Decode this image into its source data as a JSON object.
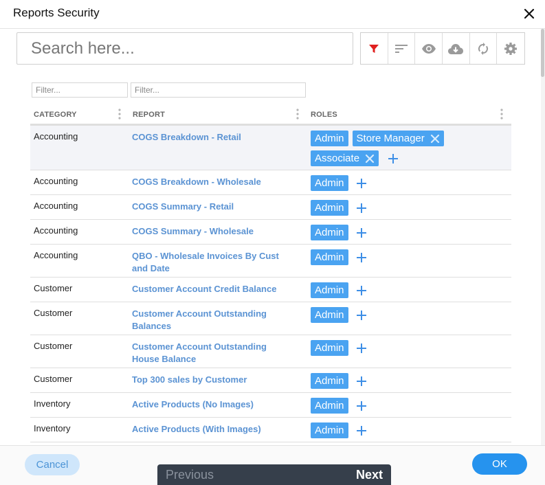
{
  "dialog": {
    "title": "Reports Security"
  },
  "search": {
    "placeholder": "Search here..."
  },
  "toolbar": {
    "icons": [
      "filter-icon",
      "sort-icon",
      "eye-icon",
      "cloud-download-icon",
      "refresh-icon",
      "gear-icon"
    ],
    "active_color": "#e0201f",
    "icon_color": "#9a9a9a"
  },
  "filters": {
    "category_placeholder": "Filter...",
    "report_placeholder": "Filter..."
  },
  "table": {
    "columns": [
      "CATEGORY",
      "REPORT",
      "ROLES"
    ],
    "add_icon": "plus-icon",
    "remove_icon": "close-icon",
    "rows": [
      {
        "category": "Accounting",
        "report": "COGS Breakdown - Retail",
        "roles": [
          "Admin",
          "Store Manager",
          "Associate"
        ]
      },
      {
        "category": "Accounting",
        "report": "COGS Breakdown - Wholesale",
        "roles": [
          "Admin"
        ]
      },
      {
        "category": "Accounting",
        "report": "COGS Summary - Retail",
        "roles": [
          "Admin"
        ]
      },
      {
        "category": "Accounting",
        "report": "COGS Summary - Wholesale",
        "roles": [
          "Admin"
        ]
      },
      {
        "category": "Accounting",
        "report": "QBO - Wholesale Invoices By Cust and Date",
        "roles": [
          "Admin"
        ]
      },
      {
        "category": "Customer",
        "report": "Customer Account Credit Balance",
        "roles": [
          "Admin"
        ]
      },
      {
        "category": "Customer",
        "report": "Customer Account Outstanding Balances",
        "roles": [
          "Admin"
        ]
      },
      {
        "category": "Customer",
        "report": "Customer Account Outstanding House Balance",
        "roles": [
          "Admin"
        ]
      },
      {
        "category": "Customer",
        "report": "Top 300 sales by Customer",
        "roles": [
          "Admin"
        ]
      },
      {
        "category": "Inventory",
        "report": "Active Products (No Images)",
        "roles": [
          "Admin"
        ]
      },
      {
        "category": "Inventory",
        "report": "Active Products (With Images)",
        "roles": [
          "Admin"
        ]
      }
    ]
  },
  "footer": {
    "cancel_label": "Cancel",
    "ok_label": "OK",
    "previous_label": "Previous",
    "next_label": "Next"
  },
  "colors": {
    "chip": "#4aa3f1",
    "link": "#5b93d3",
    "ok": "#2693ee",
    "cancel_bg": "#cfe6fb",
    "pager_bg": "#363f4b"
  }
}
